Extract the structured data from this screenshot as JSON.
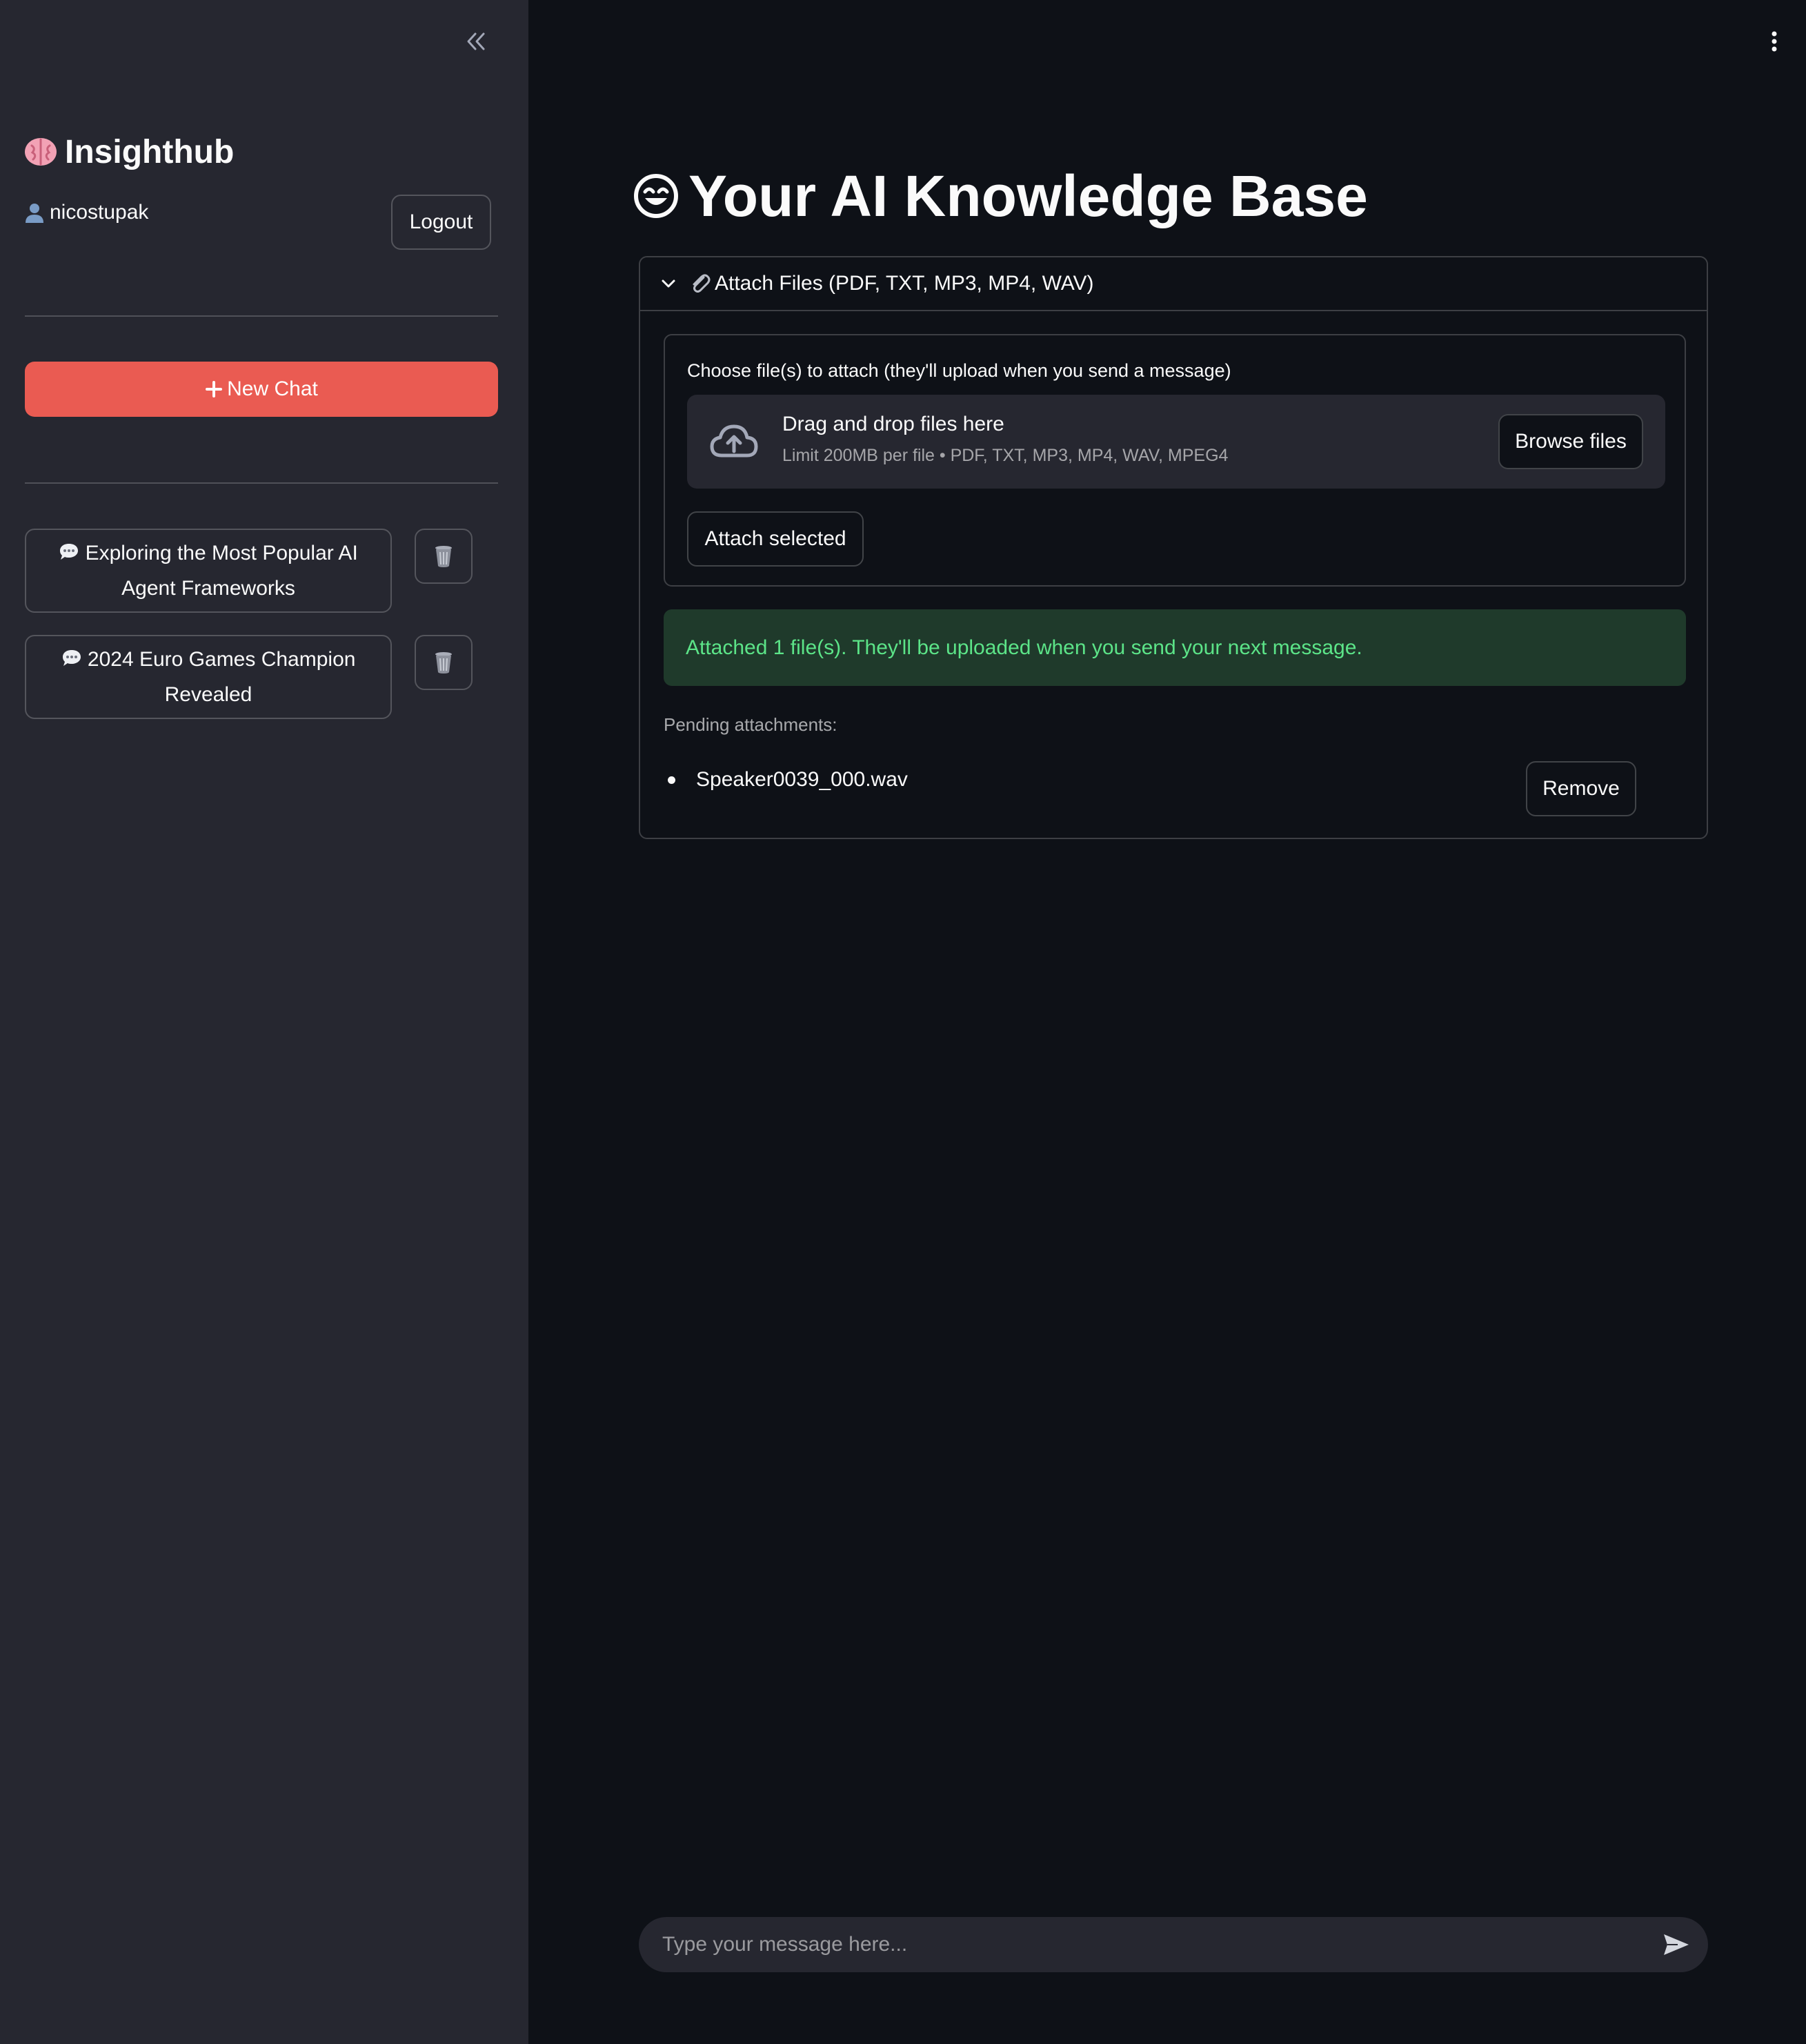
{
  "sidebar": {
    "brand_icon": "brain-icon",
    "brand": "Insighthub",
    "user_icon": "user-icon",
    "username": "nicostupak",
    "logout_label": "Logout",
    "new_chat_label": "New Chat",
    "chats": [
      {
        "title_line1": "Exploring the Most Popular AI",
        "title_line2": "Agent Frameworks",
        "icon": "speech-bubble-icon"
      },
      {
        "title_line1": "2024 Euro Games Champion",
        "title_line2": "Revealed",
        "icon": "speech-bubble-icon"
      }
    ],
    "accent_color": "#ea5b52"
  },
  "main": {
    "title_icon": "smiling-face-icon",
    "title": "Your AI Knowledge Base",
    "expander": {
      "label": "Attach Files (PDF, TXT, MP3, MP4, WAV)",
      "icon": "paperclip-icon",
      "expanded": true
    },
    "uploader": {
      "label": "Choose file(s) to attach (they'll upload when you send a message)",
      "drag_text": "Drag and drop files here",
      "limit_text": "Limit 200MB per file • PDF, TXT, MP3, MP4, WAV, MPEG4",
      "browse_label": "Browse files",
      "attach_label": "Attach selected"
    },
    "success_message": "Attached 1 file(s). They'll be uploaded when you send your next message.",
    "pending_label": "Pending attachments:",
    "pending_files": [
      "Speaker0039_000.wav"
    ],
    "remove_label": "Remove"
  },
  "chat_input": {
    "placeholder": "Type your message here...",
    "value": ""
  },
  "colors": {
    "background": "#0e1117",
    "sidebar": "#262730",
    "success_bg": "#1f3a2b",
    "success_text": "#5ce488"
  }
}
